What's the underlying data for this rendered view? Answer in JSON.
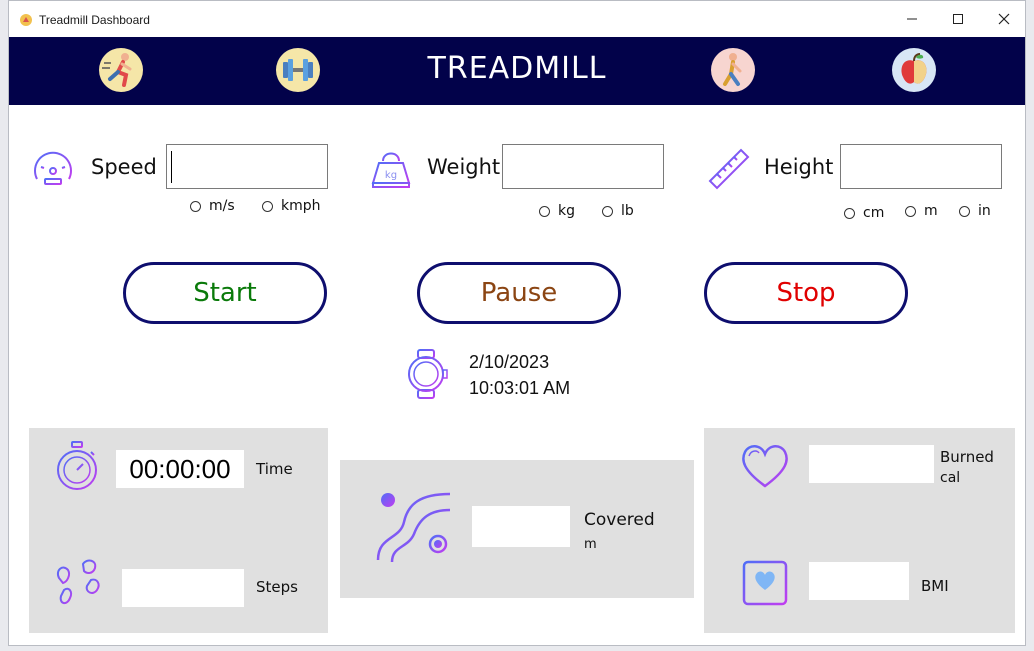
{
  "window": {
    "title": "Treadmill Dashboard"
  },
  "banner": {
    "title": "TREADMILL",
    "bg_color": "#02024a"
  },
  "icons": {
    "banner": [
      "runner-icon",
      "dumbbell-icon",
      "walker-icon",
      "apple-icon"
    ],
    "speed": "speedometer-icon",
    "weight": "kettlebell-icon",
    "height": "ruler-icon",
    "clock": "smartwatch-icon",
    "time": "stopwatch-icon",
    "steps": "footprints-icon",
    "route": "route-icon",
    "calories": "heart-icon",
    "bmi": "heart-square-icon"
  },
  "inputs": {
    "speed": {
      "label": "Speed",
      "value": "",
      "units": [
        "m/s",
        "kmph"
      ]
    },
    "weight": {
      "label": "Weight",
      "value": "",
      "units": [
        "kg",
        "lb"
      ]
    },
    "height": {
      "label": "Height",
      "value": "",
      "units": [
        "cm",
        "m",
        "in"
      ]
    }
  },
  "buttons": {
    "start": {
      "label": "Start",
      "color": "#0a7a0a"
    },
    "pause": {
      "label": "Pause",
      "color": "#8b4513"
    },
    "stop": {
      "label": "Stop",
      "color": "#e00000"
    }
  },
  "datetime": {
    "date": "2/10/2023",
    "time": "10:03:01 AM"
  },
  "stats": {
    "timer": {
      "value": "00:00:00",
      "label": "Time"
    },
    "steps": {
      "value": "",
      "label": "Steps"
    },
    "distance": {
      "value": "",
      "label": "Covered",
      "unit": "m"
    },
    "calories": {
      "value": "",
      "label": "Burned",
      "unit": "cal"
    },
    "bmi": {
      "value": "",
      "label": "BMI"
    }
  }
}
